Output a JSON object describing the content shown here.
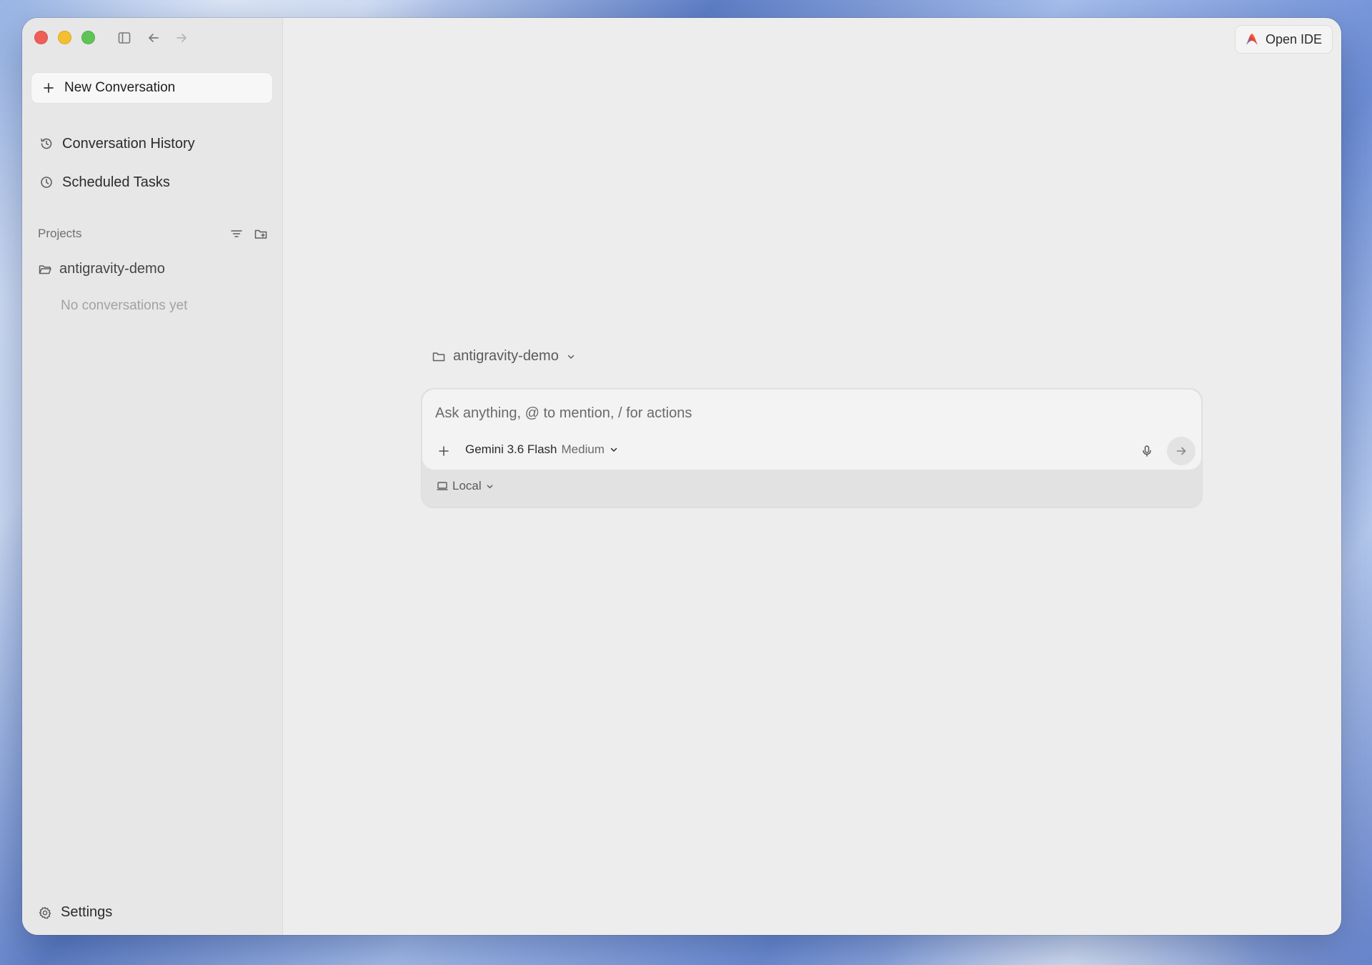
{
  "window": {
    "traffic_lights": [
      "close",
      "minimize",
      "zoom"
    ]
  },
  "toolbar": {
    "icons": [
      "sidebar-toggle-icon",
      "back-arrow-icon",
      "forward-arrow-icon"
    ]
  },
  "sidebar": {
    "new_conversation_label": "New Conversation",
    "history_label": "Conversation History",
    "scheduled_label": "Scheduled Tasks",
    "projects_heading": "Projects",
    "projects": [
      {
        "name": "antigravity-demo",
        "empty_text": "No conversations yet"
      }
    ],
    "settings_label": "Settings"
  },
  "header": {
    "open_ide_label": "Open IDE"
  },
  "composer": {
    "project_selector": "antigravity-demo",
    "placeholder": "Ask anything, @ to mention, / for actions",
    "value": "",
    "model_name": "Gemini 3.6 Flash",
    "model_variant": "Medium",
    "environment": "Local"
  },
  "colors": {
    "window_bg": "#eeeded",
    "sidebar_bg": "#e8e7e7",
    "close": "#ee5f57",
    "minimize": "#f4bf2f",
    "zoom": "#5fc455"
  }
}
